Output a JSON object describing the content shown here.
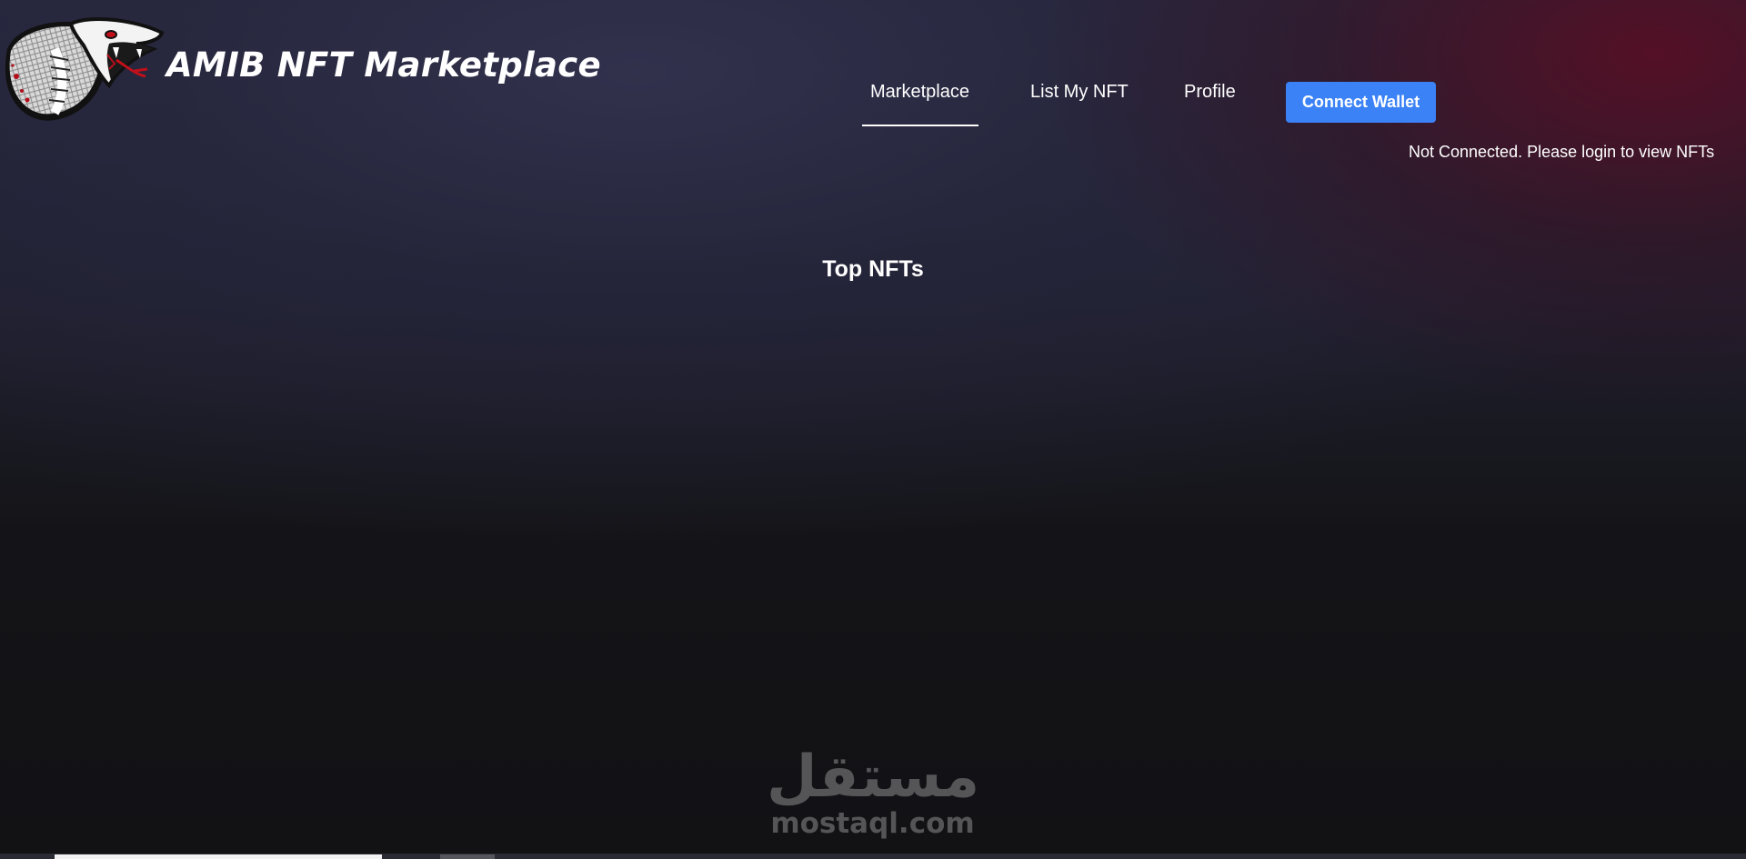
{
  "header": {
    "site_title": "AMIB NFT Marketplace",
    "logo_icon": "cobra-snake-logo"
  },
  "nav": {
    "items": [
      {
        "label": "Marketplace",
        "active": true
      },
      {
        "label": "List My NFT",
        "active": false
      },
      {
        "label": "Profile",
        "active": false
      }
    ],
    "connect_button": "Connect Wallet"
  },
  "status": {
    "message": "Not Connected. Please login to view NFTs"
  },
  "main": {
    "section_title": "Top NFTs"
  },
  "watermark": {
    "arabic": "مستقل",
    "latin": "mostaql.com"
  },
  "colors": {
    "accent": "#3b82f6",
    "background_dark": "#121215",
    "background_top": "#26263c",
    "glow_red": "#5c0c22",
    "text": "#ffffff"
  }
}
